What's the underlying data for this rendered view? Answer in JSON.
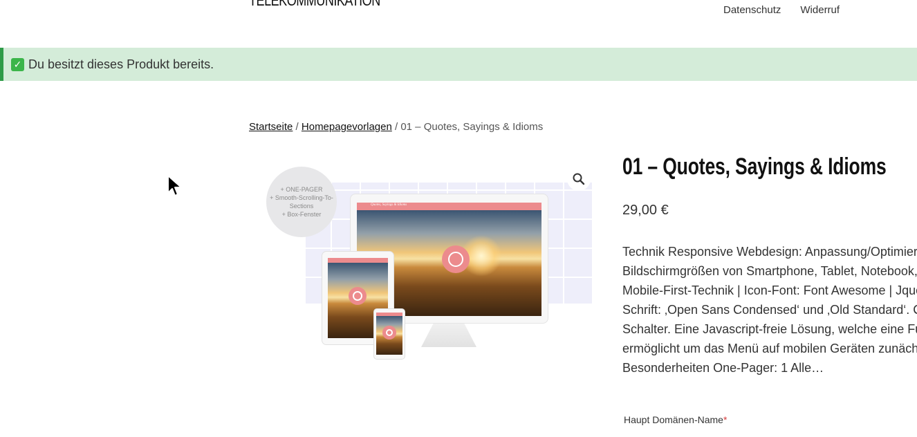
{
  "header": {
    "site_title": "TELEKOMMUNIKATION",
    "nav": [
      "Datenschutz",
      "Widerruf"
    ]
  },
  "notice": {
    "text": "Du besitzt dieses Produkt bereits.",
    "icon": "check-mark-icon",
    "bg_color": "#d4ecd9",
    "accent_color": "#2e9b48"
  },
  "breadcrumb": {
    "home": "Startseite",
    "sep": "/",
    "category": "Homepagevorlagen",
    "current": "01 – Quotes, Sayings & Idioms"
  },
  "gallery": {
    "badge_lines": [
      "+ ONE-PAGER",
      "+ Smooth-Scrolling-To-",
      "Sections",
      "+ Box-Fenster"
    ],
    "zoom_icon": "magnifier-icon",
    "screen_header": "Quotes, Sayings & Idioms",
    "accent_color": "#ec8b8d"
  },
  "product": {
    "title": "01 – Quotes, Sayings & Idioms",
    "price": "29,00 €",
    "description_lines": [
      "Technik Responsive Webdesign: Anpassung/Optimier",
      "Bildschirmgrößen von Smartphone, Tablet, Notebook,",
      "Mobile-First-Technik | Icon-Font: Font Awesome | Jque",
      "Schrift: ‚Open Sans Condensed‘ und ‚Old Standard‘. CS",
      "Schalter. Eine Javascript-freie Lösung, welche eine Fu",
      "ermöglicht um das Menü auf mobilen Geräten zunäch",
      "Besonderheiten One-Pager: 1 Alle…"
    ],
    "field_label": "Haupt Domänen-Name",
    "required_mark": "*"
  }
}
